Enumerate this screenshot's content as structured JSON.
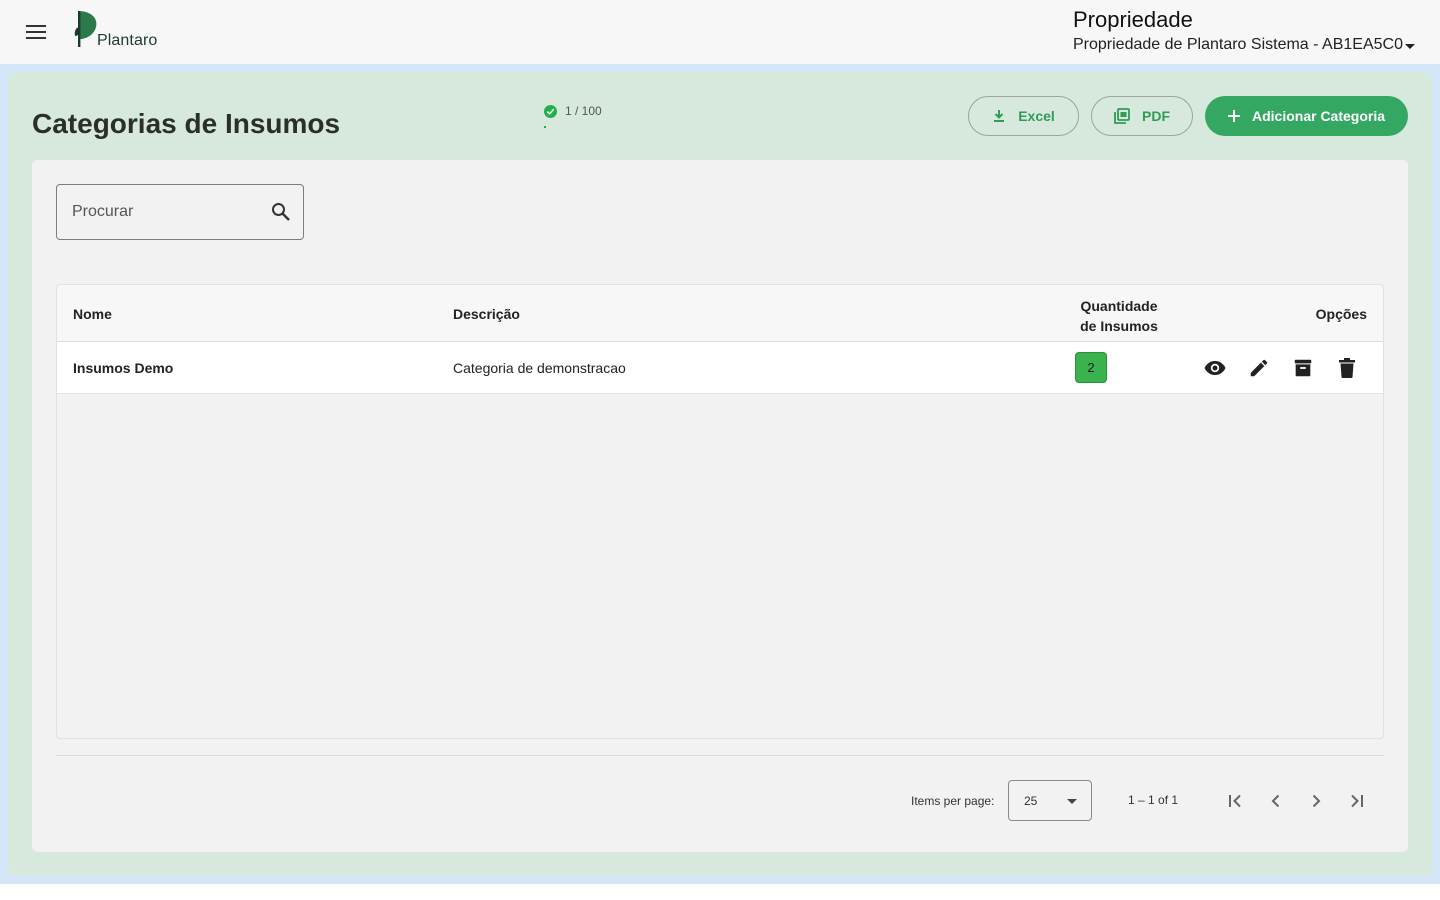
{
  "header": {
    "logo_text": "Plantaro",
    "property_title": "Propriedade",
    "property_selected": "Propriedade de Plantaro Sistema - AB1EA5C0",
    "icons": {
      "menu": "menu-icon",
      "dropdown": "caret-down-icon"
    }
  },
  "page": {
    "title": "Categorias de Insumos",
    "usage": {
      "text": "1 / 100",
      "used": 1,
      "limit": 100,
      "fraction": 0.01
    },
    "buttons": {
      "excel": "Excel",
      "pdf": "PDF",
      "add": "Adicionar Categoria"
    }
  },
  "search": {
    "placeholder": "Procurar",
    "value": ""
  },
  "table": {
    "headers": {
      "nome": "Nome",
      "descricao": "Descrição",
      "quantidade_line1": "Quantidade",
      "quantidade_line2": "de Insumos",
      "opcoes": "Opções"
    },
    "rows": [
      {
        "nome": "Insumos Demo",
        "descricao": "Categoria de demonstracao",
        "quantidade": "2"
      }
    ],
    "row_actions": [
      "view-icon",
      "edit-icon",
      "archive-icon",
      "delete-icon"
    ]
  },
  "paginator": {
    "items_per_page_label": "Items per page:",
    "items_per_page": "25",
    "range": "1 – 1 of 1"
  },
  "colors": {
    "primary_green": "#34a862",
    "panel_bg": "#d7e8dc",
    "frame_bg": "#d3e7f8",
    "badge_green": "#3ab24e"
  }
}
